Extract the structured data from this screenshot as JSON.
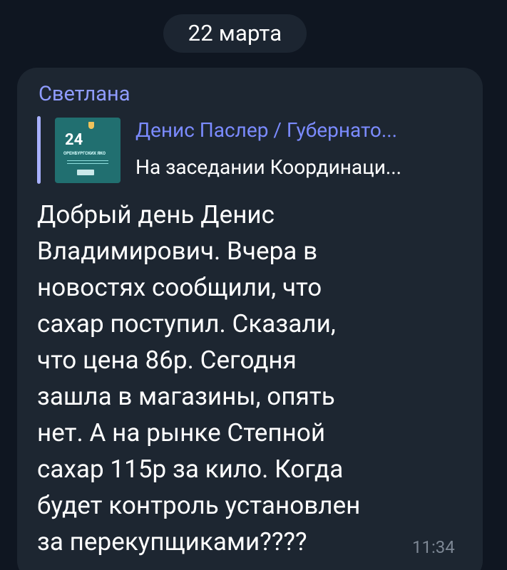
{
  "date_label": "22 марта",
  "message": {
    "sender": "Светлана",
    "reply": {
      "title": "Денис Паслер / Губернато...",
      "text": "На заседании Координаци...",
      "thumbnail": {
        "number": "24",
        "caption": "ОРЕНБУРГСКИХ ЯКО"
      }
    },
    "lines": [
      "Добрый день Денис",
      "Владимирович. Вчера в",
      "новостях сообщили, что",
      "сахар поступил. Сказали,",
      "что цена 86р. Сегодня",
      "зашла в магазины, опять",
      "нет. А на рынке Степной",
      "сахар 115р за кило. Когда",
      "будет контроль установлен",
      "за перекупщиками????"
    ],
    "time": "11:34"
  },
  "colors": {
    "background": "#0f1621",
    "bubble": "#1d2631",
    "date_pill": "#1c2531",
    "sender": "#8f9cff",
    "reply_bar": "#a8b1ff",
    "reply_title": "#7b8bff",
    "thumbnail": "#216f70",
    "text": "#ffffff",
    "time": "#7d8794"
  }
}
